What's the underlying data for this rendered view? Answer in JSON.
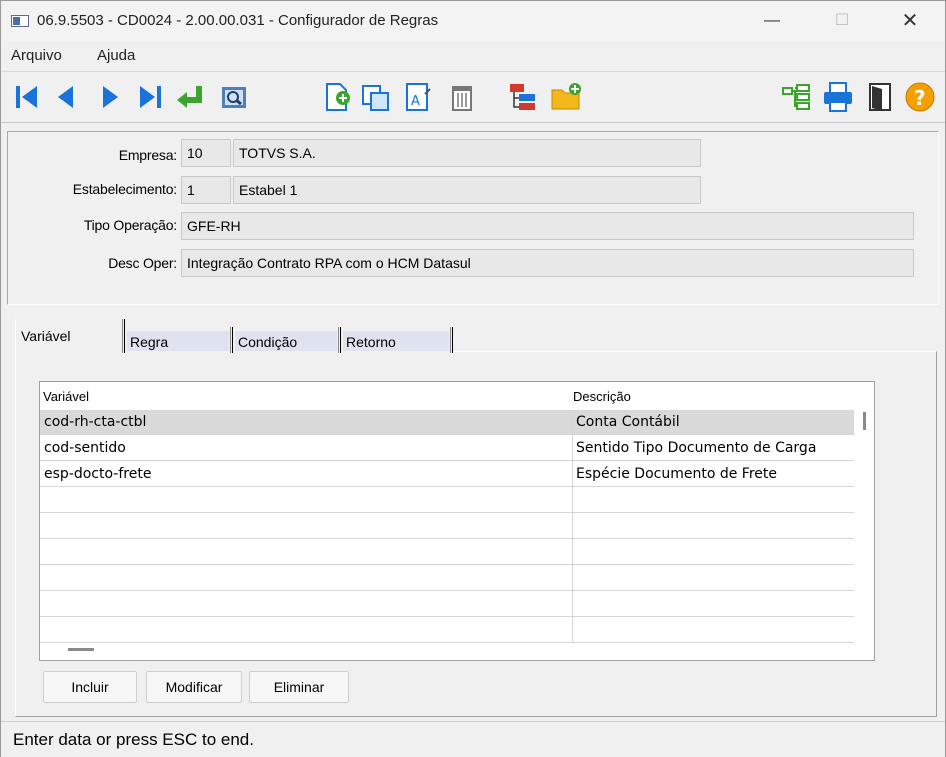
{
  "window": {
    "title": "06.9.5503 - CD0024 - 2.00.00.031 - Configurador de Regras",
    "controls": {
      "minimize": "—",
      "maximize": "☐",
      "close": "✕"
    }
  },
  "menu": {
    "items": [
      "Arquivo",
      "Ajuda"
    ]
  },
  "toolbar": {
    "buttons": [
      "first-icon",
      "previous-icon",
      "next-icon",
      "last-icon",
      "goto-icon",
      "search-icon",
      "new-icon",
      "copy-icon",
      "edit-icon",
      "delete-icon",
      "tree-icon",
      "new-folder-icon",
      "tree-list-icon",
      "print-icon",
      "exit-icon",
      "help-icon"
    ],
    "help_glyph": "?"
  },
  "header": {
    "empresa": {
      "label": "Empresa:",
      "code": "10",
      "name": "TOTVS S.A."
    },
    "estabelecimento": {
      "label": "Estabelecimento:",
      "code": "1",
      "name": "Estabel 1"
    },
    "tipo_operacao": {
      "label": "Tipo Operação:",
      "value": "GFE-RH"
    },
    "desc_oper": {
      "label": "Desc Oper:",
      "value": "Integração Contrato RPA com o HCM Datasul"
    }
  },
  "tabs": [
    "Variável",
    "Regra",
    "Condição",
    "Retorno"
  ],
  "grid": {
    "columns": [
      "Variável",
      "Descrição"
    ],
    "rows": [
      {
        "variavel": "cod-rh-cta-ctbl",
        "descricao": "Conta Contábil"
      },
      {
        "variavel": "cod-sentido",
        "descricao": "Sentido Tipo Documento de Carga"
      },
      {
        "variavel": "esp-docto-frete",
        "descricao": "Espécie Documento de Frete"
      }
    ]
  },
  "buttons": {
    "incluir": "Incluir",
    "modificar": "Modificar",
    "eliminar": "Eliminar"
  },
  "status": {
    "text": "Enter data or press ESC to end."
  },
  "colors": {
    "selected_row": "#d9d9d9",
    "field_bg": "#e8e8e8",
    "tab_bg": "#dfe3ef"
  }
}
